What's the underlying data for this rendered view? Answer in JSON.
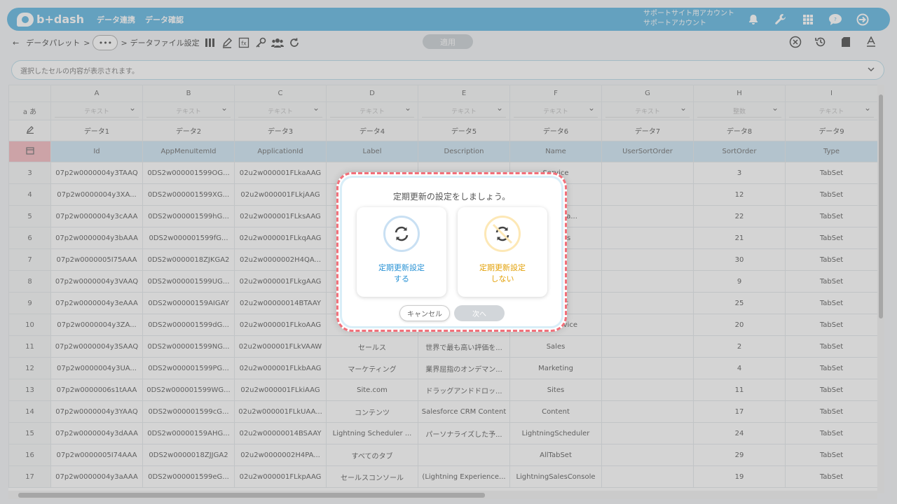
{
  "app": {
    "logo": "b+dash",
    "nav": [
      "データ連携",
      "データ確認"
    ],
    "account_line1": "サポートサイト用アカウント",
    "account_line2": "サポートアカウント"
  },
  "toolbar": {
    "crumb1": "データパレット",
    "sep": ">",
    "ellipsis": "•••",
    "crumb2": "データファイル設定",
    "apply": "適用"
  },
  "formula": {
    "placeholder": "選択したセルの内容が表示されます。"
  },
  "grid": {
    "columns": [
      "A",
      "B",
      "C",
      "D",
      "E",
      "F",
      "G",
      "H",
      "I"
    ],
    "type_row_label": "a あ",
    "types": [
      "テキスト",
      "テキスト",
      "テキスト",
      "テキスト",
      "テキスト",
      "テキスト",
      "テキスト",
      "整数",
      "テキスト"
    ],
    "display_names": [
      "データ1",
      "データ2",
      "データ3",
      "データ4",
      "データ5",
      "データ6",
      "データ7",
      "データ8",
      "データ9"
    ],
    "api_names": [
      "Id",
      "AppMenuItemId",
      "ApplicationId",
      "Label",
      "Description",
      "Name",
      "UserSortOrder",
      "SortOrder",
      "Type"
    ],
    "rows": [
      {
        "n": "3",
        "cells": [
          "07p2w0000004y3TAAQ",
          "0DS2w000001599OG...",
          "02u2w000001FLkaAAG",
          "",
          "",
          "Service",
          "",
          "3",
          "TabSet"
        ]
      },
      {
        "n": "4",
        "cells": [
          "07p2w0000004y3XA...",
          "0DS2w000001599XG...",
          "02u2w000001FLkjAAG",
          "",
          "",
          "...r",
          "",
          "12",
          "TabSet"
        ]
      },
      {
        "n": "5",
        "cells": [
          "07p2w0000004y3cAAA",
          "0DS2w000001599hG...",
          "02u2w000001FLksAAG",
          "L...",
          "",
          "...rumenta...",
          "",
          "22",
          "TabSet"
        ]
      },
      {
        "n": "6",
        "cells": [
          "07p2w0000004y3bAAA",
          "0DS2w000001599fG...",
          "02u2w000001FLkqAAG",
          "",
          "",
          "...gSales",
          "",
          "21",
          "TabSet"
        ]
      },
      {
        "n": "7",
        "cells": [
          "07p2w0000005I75AAA",
          "0DS2w0000018ZJKGA2",
          "02u2w0000002H4QA...",
          "",
          "",
          "...rce",
          "",
          "30",
          "TabSet"
        ]
      },
      {
        "n": "8",
        "cells": [
          "07p2w0000004y3VAAQ",
          "0DS2w000001599UG...",
          "02u2w000001FLkgAAG",
          "",
          "",
          "...cher",
          "",
          "9",
          "TabSet"
        ]
      },
      {
        "n": "9",
        "cells": [
          "07p2w0000004y3eAAA",
          "0DS2w00000159AIGAY",
          "02u2w00000014BTAAY",
          "",
          "",
          "...nBolt",
          "",
          "25",
          "TabSet"
        ]
      },
      {
        "n": "10",
        "cells": [
          "07p2w0000004y3ZA...",
          "0DS2w000001599dG...",
          "02u2w000001FLkoAAG",
          "",
          "",
          "...ingService",
          "",
          "20",
          "TabSet"
        ]
      },
      {
        "n": "11",
        "cells": [
          "07p2w0000004y3SAAQ",
          "0DS2w000001599NG...",
          "02u2w000001FLkVAAW",
          "セールス",
          "世界で最も高い評価を...",
          "Sales",
          "",
          "2",
          "TabSet"
        ]
      },
      {
        "n": "12",
        "cells": [
          "07p2w0000004y3UA...",
          "0DS2w000001599PG...",
          "02u2w000001FLkbAAG",
          "マーケティング",
          "業界屈指のオンデマン...",
          "Marketing",
          "",
          "4",
          "TabSet"
        ]
      },
      {
        "n": "13",
        "cells": [
          "07p2w0000006s1tAAA",
          "0DS2w000001599WG...",
          "02u2w000001FLkiAAG",
          "Site.com",
          "ドラッグアンドドロッ...",
          "Sites",
          "",
          "11",
          "TabSet"
        ]
      },
      {
        "n": "14",
        "cells": [
          "07p2w0000004y3YAAQ",
          "0DS2w000001599cG...",
          "02u2w000001FLkUAA...",
          "コンテンツ",
          "Salesforce CRM Content",
          "Content",
          "",
          "17",
          "TabSet"
        ]
      },
      {
        "n": "15",
        "cells": [
          "07p2w0000004y3dAAA",
          "0DS2w00000159AHG...",
          "02u2w00000014BSAAY",
          "Lightning Scheduler ...",
          "パーソナライズした予...",
          "LightningScheduler",
          "",
          "24",
          "TabSet"
        ]
      },
      {
        "n": "16",
        "cells": [
          "07p2w0000005I74AAA",
          "0DS2w0000018ZJJGA2",
          "02u2w0000002H4PA...",
          "すべてのタブ",
          "",
          "AllTabSet",
          "",
          "29",
          "TabSet"
        ]
      },
      {
        "n": "17",
        "cells": [
          "07p2w0000004y3aAAA",
          "0DS2w000001599eG...",
          "02u2w000001FLkpAAG",
          "セールスコンソール",
          "(Lightning Experience...",
          "LightningSalesConsole",
          "",
          "19",
          "TabSet"
        ]
      }
    ]
  },
  "dialog": {
    "title": "定期更新の設定をしましょう。",
    "yes_line1": "定期更新設定",
    "yes_line2": "する",
    "no_line1": "定期更新設定",
    "no_line2": "しない",
    "cancel": "キャンセル",
    "next": "次へ"
  },
  "colors": {
    "brand": "#5ab4e0",
    "yes": "#2a93d5",
    "no": "#e3a20b",
    "highlight": "#f2707a"
  }
}
